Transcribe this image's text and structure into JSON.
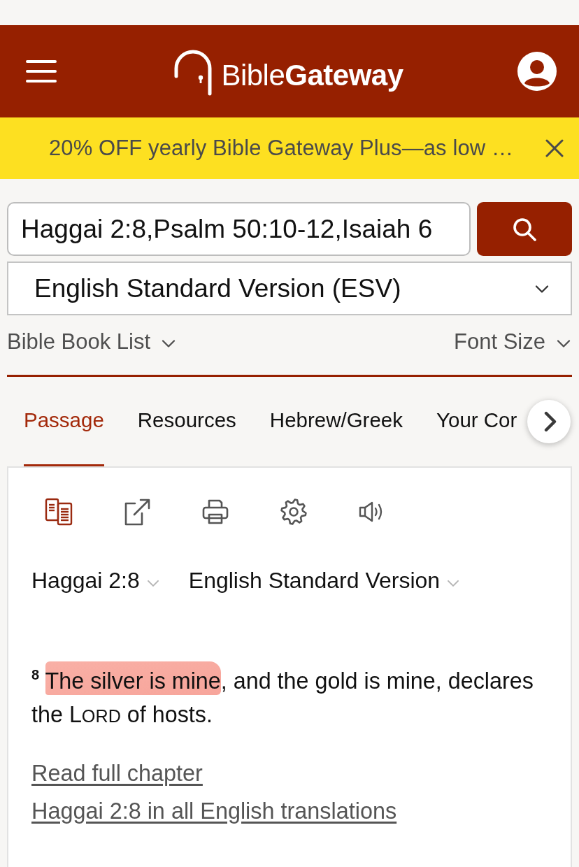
{
  "header": {
    "logo_text": "Bible**Gateway**"
  },
  "promo_banner": {
    "text": "20% OFF yearly Bible Gateway Plus—as low …"
  },
  "search": {
    "value": "Haggai 2:8,Psalm 50:10-12,Isaiah 6"
  },
  "version_select": {
    "value": "English Standard Version (ESV)"
  },
  "book_list": {
    "label": "Bible Book List"
  },
  "font_size": {
    "label": "Font Size"
  },
  "tabs": [
    {
      "label": "Passage",
      "selected": true
    },
    {
      "label": "Resources",
      "selected": false
    },
    {
      "label": "Hebrew/Greek",
      "selected": false
    },
    {
      "label": "Your Cor",
      "selected": false
    }
  ],
  "passage": {
    "toolbar": [
      {
        "kind": "parallel",
        "selected": true
      },
      {
        "kind": "share",
        "selected": false
      },
      {
        "kind": "print",
        "selected": false
      },
      {
        "kind": "settings",
        "selected": false
      },
      {
        "kind": "audio",
        "selected": false
      }
    ],
    "reference": "Haggai 2:8",
    "version": "English Standard Version",
    "verse": {
      "number": "8",
      "segments": [
        {
          "kind": "highlight",
          "text": "The silver is mine"
        },
        {
          "kind": "plain",
          "text": ", and the gold is mine, declares the "
        },
        {
          "kind": "smallcaps",
          "text": "LORD"
        },
        {
          "kind": "plain",
          "text": " of hosts."
        }
      ]
    },
    "links": [
      "Read full chapter",
      "Haggai 2:8 in all English translations"
    ]
  }
}
